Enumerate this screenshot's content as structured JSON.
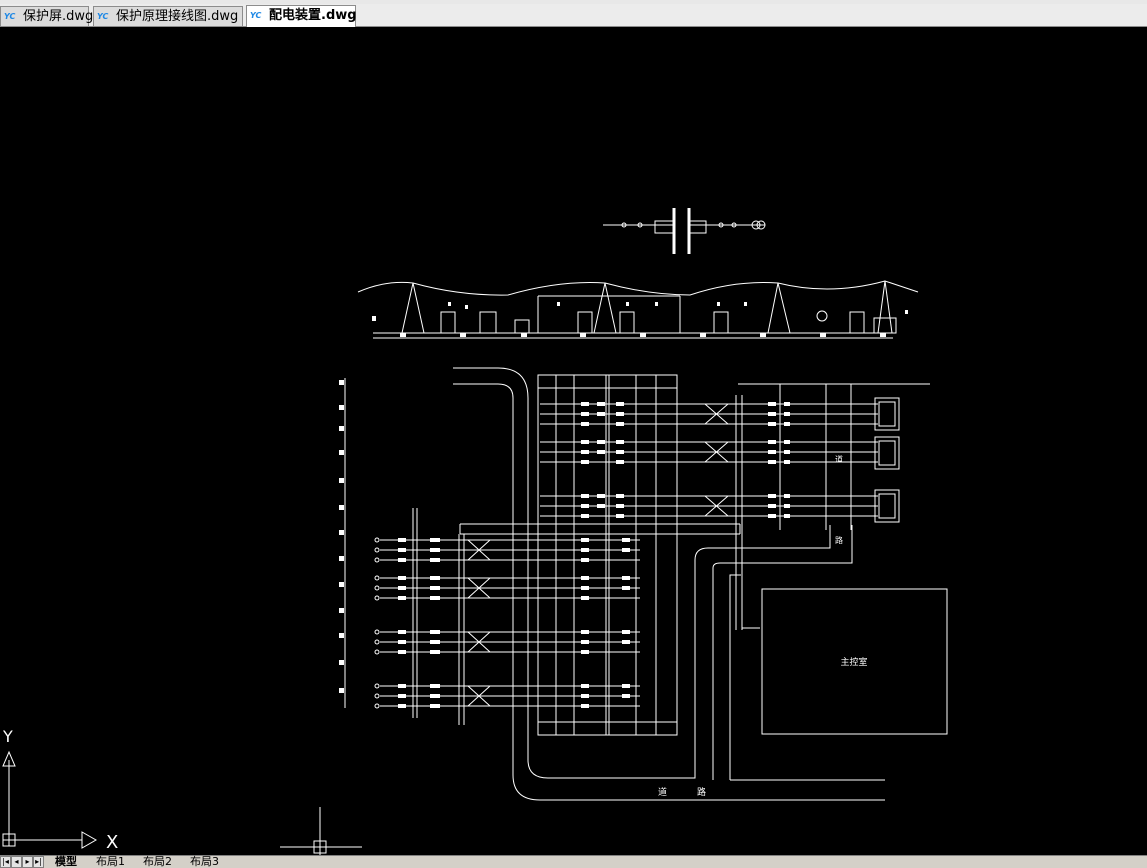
{
  "tabs": [
    {
      "label": "保护屏.dwg",
      "active": false
    },
    {
      "label": "保护原理接线图.dwg",
      "active": false
    },
    {
      "label": "配电装置.dwg",
      "active": true
    }
  ],
  "tab_icon": "yc-cad-file-icon",
  "drawing": {
    "room_label": "主控室",
    "road_label_h1": "道",
    "road_label_h2": "路",
    "road_label_v1": "路",
    "road_label_v2": "道"
  },
  "ucs": {
    "y_label": "Y",
    "x_label": "X"
  },
  "layout_tabs": [
    {
      "label": "模型",
      "active": true
    },
    {
      "label": "布局1",
      "active": false
    },
    {
      "label": "布局2",
      "active": false
    },
    {
      "label": "布局3",
      "active": false
    }
  ],
  "colors": {
    "background": "#000000",
    "linework": "#ffffff",
    "tab_icon": "#1e88e5"
  }
}
